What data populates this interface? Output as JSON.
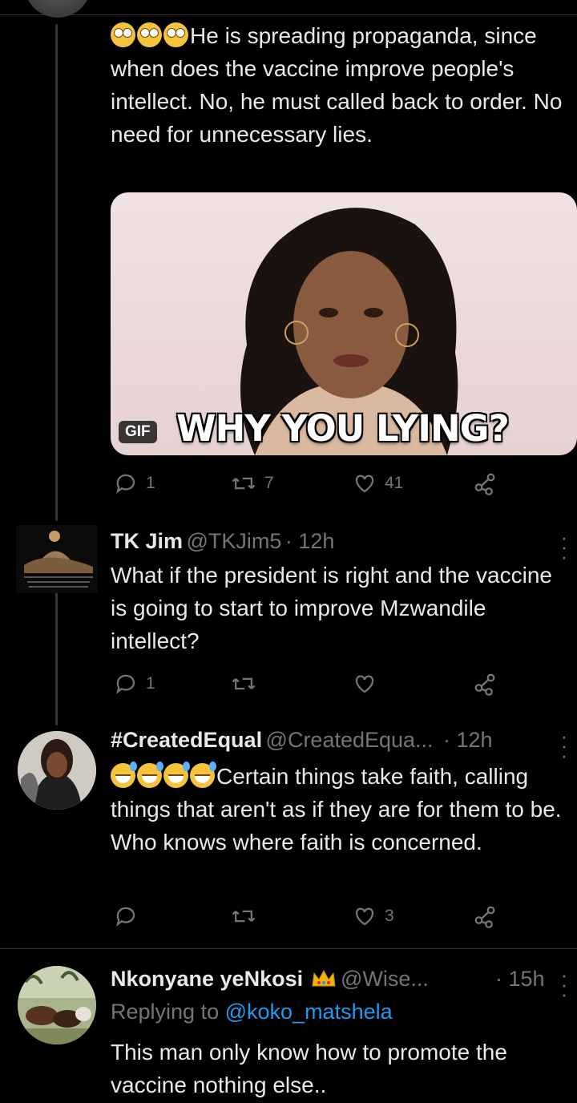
{
  "tweets": [
    {
      "text": "He is spreading propaganda, since when does the vaccine improve people's intellect. No, he must called back to order. No need for unnecessary lies.",
      "gif": {
        "badge": "GIF",
        "caption": "WHY YOU LYING?"
      },
      "actions": {
        "replies": "1",
        "retweets": "7",
        "likes": "41"
      }
    },
    {
      "name": "TK Jim",
      "handle": "@TKJim5",
      "time": "· 12h",
      "text": "What if the president is right and the vaccine is going to start to improve Mzwandile intellect?",
      "actions": {
        "replies": "1",
        "retweets": "",
        "likes": ""
      }
    },
    {
      "name": "#CreatedEqual",
      "handle": "@CreatedEqua...",
      "time": "· 12h",
      "text": "Certain things take faith, calling things that aren't as if they are for them to be. Who knows where faith is concerned.",
      "actions": {
        "replies": "",
        "retweets": "",
        "likes": "3"
      }
    },
    {
      "name": "Nkonyane yeNkosi",
      "badge_icon": "crown-emoji",
      "handle": "@Wise...",
      "time": "· 15h",
      "replying_label": "Replying to",
      "replying_handle": "@koko_matshela",
      "text": "This man only know how to promote the vaccine nothing else.."
    }
  ],
  "colors": {
    "background": "#000000",
    "text": "#e7e9ea",
    "muted": "#71767b",
    "link": "#1d9bf0"
  }
}
